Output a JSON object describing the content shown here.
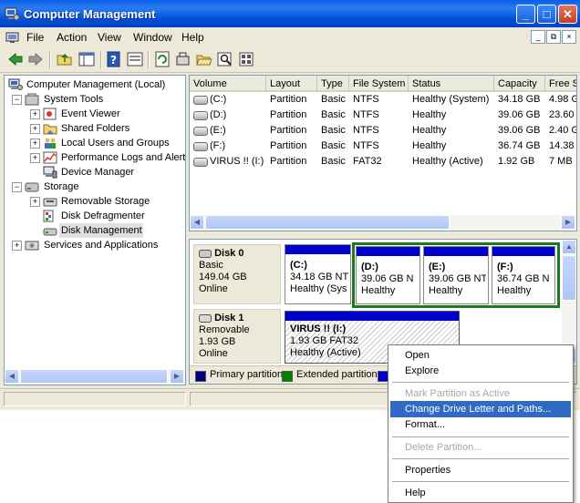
{
  "window": {
    "title": "Computer Management"
  },
  "menubar": [
    "File",
    "Action",
    "View",
    "Window",
    "Help"
  ],
  "mdi_buttons": [
    "_",
    "⧉",
    "×"
  ],
  "tree": {
    "root": "Computer Management (Local)",
    "items": [
      {
        "label": "System Tools",
        "expanded": true
      },
      {
        "label": "Event Viewer"
      },
      {
        "label": "Shared Folders"
      },
      {
        "label": "Local Users and Groups"
      },
      {
        "label": "Performance Logs and Alerts"
      },
      {
        "label": "Device Manager"
      },
      {
        "label": "Storage",
        "expanded": true
      },
      {
        "label": "Removable Storage"
      },
      {
        "label": "Disk Defragmenter"
      },
      {
        "label": "Disk Management",
        "selected": true
      },
      {
        "label": "Services and Applications"
      }
    ]
  },
  "volume_list": {
    "columns": [
      "Volume",
      "Layout",
      "Type",
      "File System",
      "Status",
      "Capacity",
      "Free Sp"
    ],
    "rows": [
      [
        "(C:)",
        "Partition",
        "Basic",
        "NTFS",
        "Healthy (System)",
        "34.18 GB",
        "4.98 G"
      ],
      [
        "(D:)",
        "Partition",
        "Basic",
        "NTFS",
        "Healthy",
        "39.06 GB",
        "23.60"
      ],
      [
        "(E:)",
        "Partition",
        "Basic",
        "NTFS",
        "Healthy",
        "39.06 GB",
        "2.40 G"
      ],
      [
        "(F:)",
        "Partition",
        "Basic",
        "NTFS",
        "Healthy",
        "36.74 GB",
        "14.38"
      ],
      [
        "VIRUS !! (I:)",
        "Partition",
        "Basic",
        "FAT32",
        "Healthy (Active)",
        "1.92 GB",
        "7 MB"
      ]
    ]
  },
  "disks": [
    {
      "name": "Disk 0",
      "type": "Basic",
      "size": "149.04 GB",
      "state": "Online",
      "partitions": [
        {
          "label": "(C:)",
          "size": "34.18 GB NT",
          "status": "Healthy (Sys"
        },
        {
          "label": "(D:)",
          "size": "39.06 GB N",
          "status": "Healthy"
        },
        {
          "label": "(E:)",
          "size": "39.06 GB NT",
          "status": "Healthy"
        },
        {
          "label": "(F:)",
          "size": "36.74 GB N",
          "status": "Healthy"
        }
      ]
    },
    {
      "name": "Disk 1",
      "type": "Removable",
      "size": "1.93 GB",
      "state": "Online",
      "partitions": [
        {
          "label": "VIRUS !!  (I:)",
          "size": "1.93 GB FAT32",
          "status": "Healthy (Active)"
        }
      ]
    }
  ],
  "legend": [
    {
      "label": "Primary partition",
      "color": "#000080"
    },
    {
      "label": "Extended partition",
      "color": "#008000"
    }
  ],
  "context_menu": {
    "items": [
      {
        "label": "Open",
        "disabled": false
      },
      {
        "label": "Explore",
        "disabled": false
      },
      {
        "label": "Mark Partition as Active",
        "disabled": true
      },
      {
        "label": "Change Drive Letter and Paths...",
        "disabled": false,
        "highlighted": true
      },
      {
        "label": "Format...",
        "disabled": false
      },
      {
        "label": "Delete Partition...",
        "disabled": true
      },
      {
        "label": "Properties",
        "disabled": false
      },
      {
        "label": "Help",
        "disabled": false
      }
    ]
  },
  "colors": {
    "titlebar": "#0a5fe8",
    "primary_partition": "#0000cc",
    "extended_border": "#1f7a1f",
    "menu_highlight": "#316ac5"
  }
}
